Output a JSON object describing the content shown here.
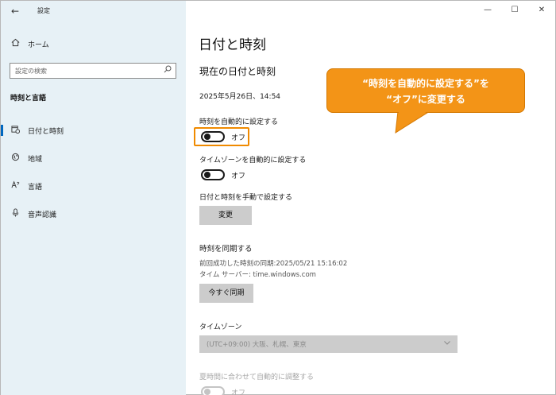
{
  "window": {
    "app_title": "設定",
    "back_glyph": "←",
    "minimize_glyph": "—",
    "maximize_glyph": "☐",
    "close_glyph": "✕"
  },
  "sidebar": {
    "home_label": "ホーム",
    "home_icon": "home-icon",
    "search_placeholder": "設定の検索",
    "section_heading": "時刻と言語",
    "items": [
      {
        "label": "日付と時刻",
        "icon": "calendar-clock-icon",
        "active": true
      },
      {
        "label": "地域",
        "icon": "globe-icon",
        "active": false
      },
      {
        "label": "言語",
        "icon": "language-icon",
        "active": false
      },
      {
        "label": "音声認識",
        "icon": "microphone-icon",
        "active": false
      }
    ]
  },
  "main": {
    "page_title": "日付と時刻",
    "current_heading": "現在の日付と時刻",
    "current_datetime": "2025年5月26日、14:54",
    "auto_time_label": "時刻を自動的に設定する",
    "auto_time_state": "オフ",
    "auto_tz_label": "タイムゾーンを自動的に設定する",
    "auto_tz_state": "オフ",
    "manual_label": "日付と時刻を手動で設定する",
    "change_button": "変更",
    "sync_heading": "時刻を同期する",
    "last_sync": "前回成功した時刻の同期:2025/05/21 15:16:02",
    "time_server": "タイム サーバー: time.windows.com",
    "sync_button": "今すぐ同期",
    "timezone_heading": "タイムゾーン",
    "timezone_value": "(UTC+09:00) 大阪、札幌、東京",
    "dst_label": "夏時間に合わせて自動的に調整する",
    "dst_state": "オフ"
  },
  "callout": {
    "line1": "“時刻を自動的に設定する”を",
    "line2": "“オフ”に変更する"
  },
  "colors": {
    "sidebar_bg": "#e7f1f6",
    "accent": "#0067c0",
    "callout": "#f39417",
    "highlight_border": "#f08a00"
  }
}
